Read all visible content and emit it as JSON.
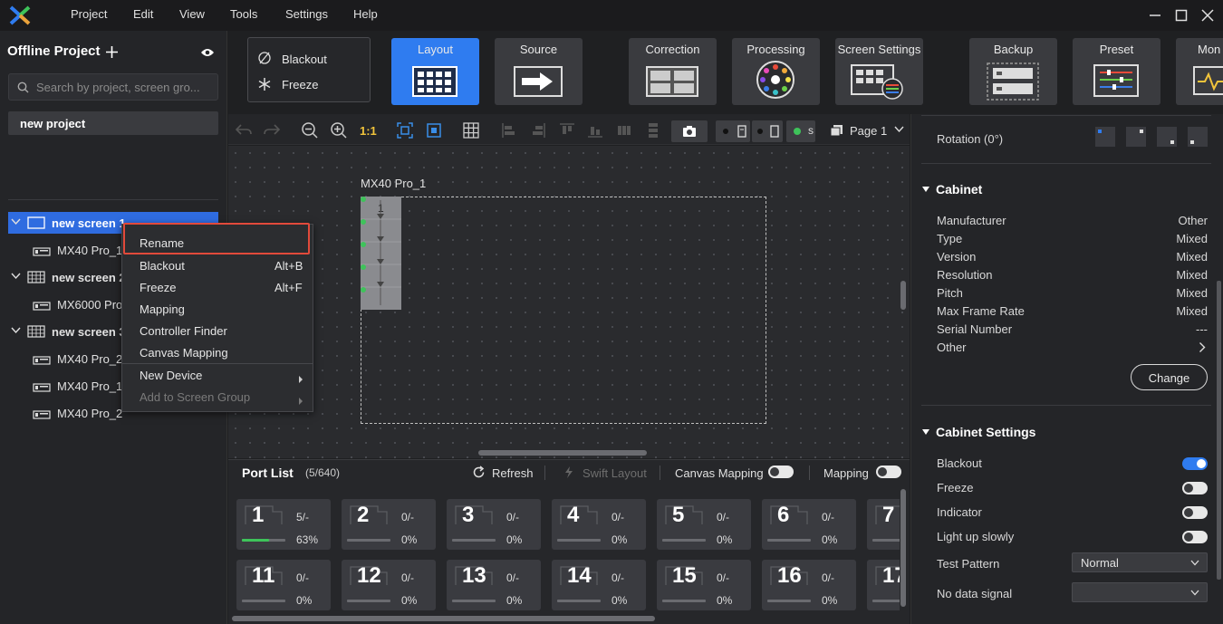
{
  "menu": [
    "Project",
    "Edit",
    "View",
    "Tools",
    "Settings",
    "Help"
  ],
  "left": {
    "title": "Offline Project",
    "search_placeholder": "Search by project, screen gro...",
    "project": "new project",
    "tree": [
      {
        "label": "new screen 1",
        "kind": "screen",
        "selected": true
      },
      {
        "label": "MX40 Pro_1",
        "kind": "device"
      },
      {
        "label": "new screen 2",
        "kind": "screen"
      },
      {
        "label": "MX6000 Pro",
        "kind": "device"
      },
      {
        "label": "new screen 3",
        "kind": "screen"
      },
      {
        "label": "MX40 Pro_2",
        "kind": "device"
      },
      {
        "label": "MX40 Pro_1",
        "kind": "device"
      },
      {
        "label": "MX40 Pro_2",
        "kind": "device"
      }
    ]
  },
  "context_menu": {
    "items": [
      {
        "label": "Rename",
        "shortcut": "",
        "highlighted": true
      },
      {
        "label": "Blackout",
        "shortcut": "Alt+B"
      },
      {
        "label": "Freeze",
        "shortcut": "Alt+F"
      },
      {
        "label": "Mapping",
        "shortcut": ""
      },
      {
        "label": "Controller Finder",
        "shortcut": ""
      },
      {
        "label": "Canvas Mapping",
        "shortcut": ""
      },
      {
        "label": "New Device",
        "shortcut": "",
        "submenu": true
      },
      {
        "label": "Add to Screen Group",
        "shortcut": "",
        "submenu": true,
        "disabled": true
      }
    ]
  },
  "ribbon": {
    "blackout": "Blackout",
    "freeze": "Freeze",
    "buttons": [
      "Layout",
      "Source",
      "Correction",
      "Processing",
      "Screen Settings",
      "Backup",
      "Preset",
      "Mon"
    ]
  },
  "canvas_toolbar": {
    "zoom_label": "1:1",
    "page": "Page 1"
  },
  "canvas": {
    "device_label": "MX40 Pro_1",
    "cabinet_number": "1"
  },
  "ports": {
    "title": "Port List",
    "count": "(5/640)",
    "refresh": "Refresh",
    "swift_layout": "Swift Layout",
    "canvas_mapping": "Canvas Mapping",
    "mapping": "Mapping",
    "items": [
      {
        "num": "1",
        "count": "5/-",
        "pct": "63%",
        "fill": 0.63
      },
      {
        "num": "2",
        "count": "0/-",
        "pct": "0%",
        "fill": 0
      },
      {
        "num": "3",
        "count": "0/-",
        "pct": "0%",
        "fill": 0
      },
      {
        "num": "4",
        "count": "0/-",
        "pct": "0%",
        "fill": 0
      },
      {
        "num": "5",
        "count": "0/-",
        "pct": "0%",
        "fill": 0
      },
      {
        "num": "6",
        "count": "0/-",
        "pct": "0%",
        "fill": 0
      },
      {
        "num": "7",
        "count": "",
        "pct": "",
        "fill": 0
      },
      {
        "num": "11",
        "count": "0/-",
        "pct": "0%",
        "fill": 0
      },
      {
        "num": "12",
        "count": "0/-",
        "pct": "0%",
        "fill": 0
      },
      {
        "num": "13",
        "count": "0/-",
        "pct": "0%",
        "fill": 0
      },
      {
        "num": "14",
        "count": "0/-",
        "pct": "0%",
        "fill": 0
      },
      {
        "num": "15",
        "count": "0/-",
        "pct": "0%",
        "fill": 0
      },
      {
        "num": "16",
        "count": "0/-",
        "pct": "0%",
        "fill": 0
      },
      {
        "num": "17",
        "count": "",
        "pct": "",
        "fill": 0
      }
    ]
  },
  "right": {
    "rotation": "Rotation (0°)",
    "cabinet_title": "Cabinet",
    "cabinet_props": [
      {
        "label": "Manufacturer",
        "value": "Other"
      },
      {
        "label": "Type",
        "value": "Mixed"
      },
      {
        "label": "Version",
        "value": "Mixed"
      },
      {
        "label": "Resolution",
        "value": "Mixed"
      },
      {
        "label": "Pitch",
        "value": "Mixed"
      },
      {
        "label": "Max Frame Rate",
        "value": "Mixed"
      },
      {
        "label": "Serial Number",
        "value": "---"
      },
      {
        "label": "Other",
        "value": ""
      }
    ],
    "change": "Change",
    "settings_title": "Cabinet Settings",
    "toggles": [
      {
        "label": "Blackout",
        "on": true
      },
      {
        "label": "Freeze",
        "on": false
      },
      {
        "label": "Indicator",
        "on": false
      },
      {
        "label": "Light up slowly",
        "on": false
      }
    ],
    "test_pattern_label": "Test Pattern",
    "test_pattern_value": "Normal",
    "no_data_label": "No data signal",
    "no_data_value": ""
  },
  "colors": {
    "accent": "#2f7cf0",
    "highlight_border": "#e24a3b",
    "progress": "#3ec35a"
  }
}
